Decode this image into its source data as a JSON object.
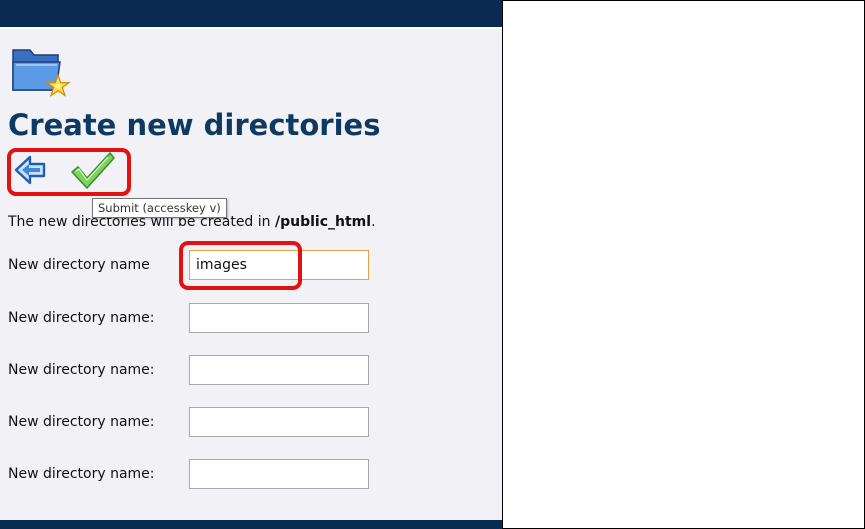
{
  "page": {
    "title": "Create new directories"
  },
  "toolbar": {
    "back_icon": "back-arrow-icon",
    "submit_icon": "checkmark-icon",
    "tooltip": "Submit (accesskey v)"
  },
  "intro": {
    "prefix": "The new ",
    "hidden_middle": "directories will be c",
    "suffix": "reated in ",
    "path": "/public_html",
    "end": "."
  },
  "form": {
    "rows": [
      {
        "label": "New directory name",
        "value": "images"
      },
      {
        "label": "New directory name:",
        "value": ""
      },
      {
        "label": "New directory name:",
        "value": ""
      },
      {
        "label": "New directory name:",
        "value": ""
      },
      {
        "label": "New directory name:",
        "value": ""
      }
    ]
  },
  "colors": {
    "header_bar": "#0b2a52",
    "title": "#0d3a62",
    "panel_background": "#f2f2f6",
    "highlight": "#e31212",
    "focused_input_border": "#e0a24a"
  }
}
